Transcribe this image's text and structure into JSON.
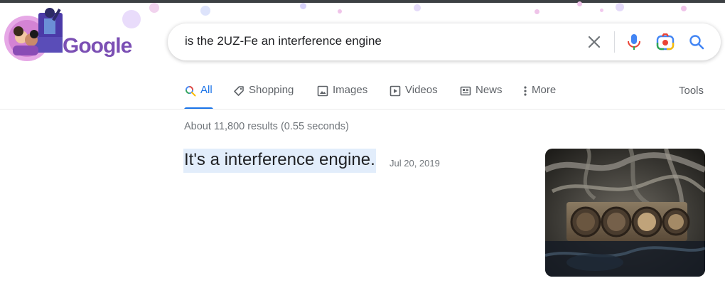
{
  "logo": {
    "text": "Google",
    "icon": "google-doodle"
  },
  "search": {
    "query": "is the 2UZ-Fe an interference engine"
  },
  "tabs": [
    {
      "label": "All",
      "icon": "search-icon",
      "active": true
    },
    {
      "label": "Shopping",
      "icon": "tag-icon"
    },
    {
      "label": "Images",
      "icon": "image-icon"
    },
    {
      "label": "Videos",
      "icon": "play-icon"
    },
    {
      "label": "News",
      "icon": "newspaper-icon"
    },
    {
      "label": "More",
      "icon": "kebab-icon"
    }
  ],
  "tools": "Tools",
  "results": {
    "stats": "About 11,800 results (0.55 seconds)",
    "answer": "It's a interference engine.",
    "date": "Jul 20, 2019",
    "thumbnail": "engine-photo"
  },
  "colors": {
    "accent": "#1a73e8",
    "highlight": "#e2edfb",
    "logo": "#7b4fb4"
  }
}
